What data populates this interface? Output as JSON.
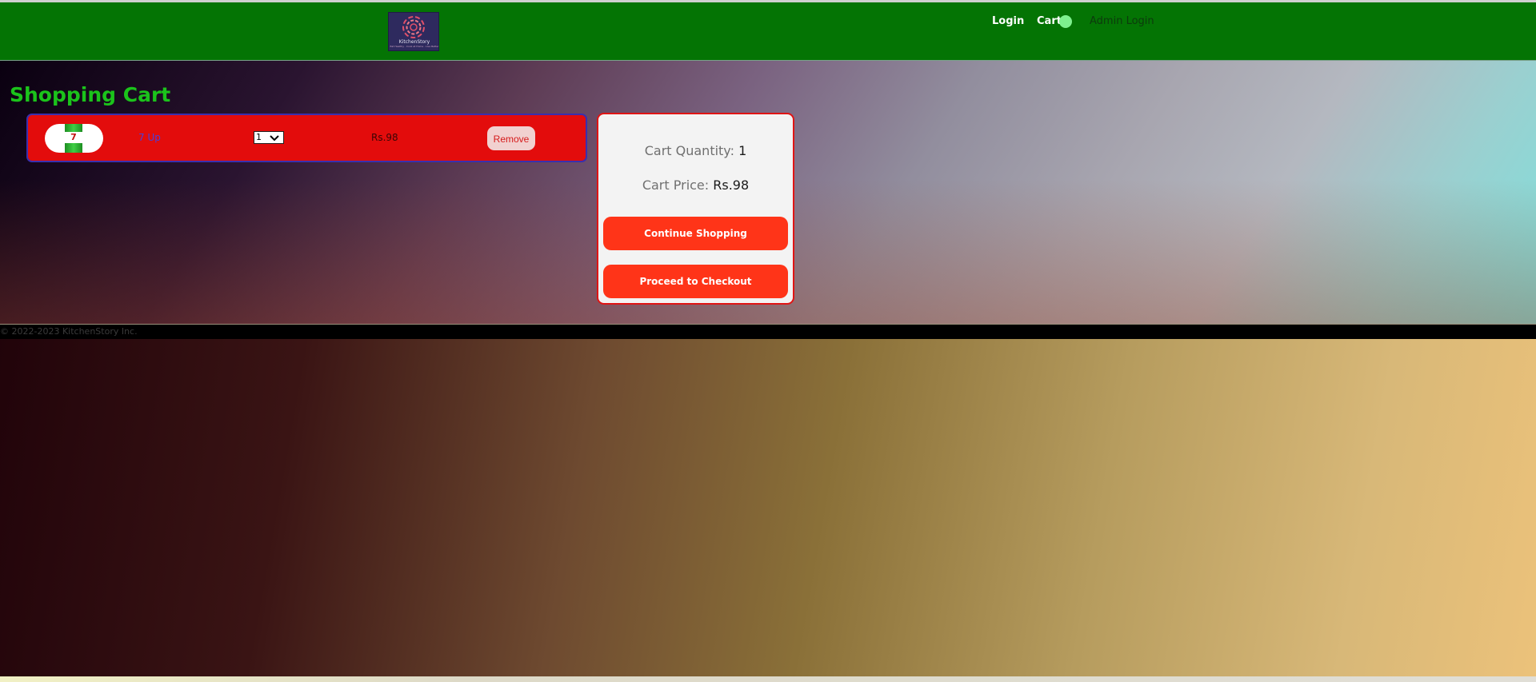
{
  "header": {
    "logo_name": "KitchenStory",
    "logo_tagline": "Eat Healthy · Cook at Home · Live Better",
    "nav": {
      "login": "Login",
      "cart": "Cart",
      "admin_login": "Admin Login"
    }
  },
  "page": {
    "title": "Shopping Cart"
  },
  "cart": {
    "items": [
      {
        "name": "7 Up",
        "quantity": "1",
        "price": "Rs.98",
        "remove_label": "Remove",
        "thumbnail_icon": "soda-can-icon"
      }
    ]
  },
  "summary": {
    "quantity_label": "Cart Quantity:",
    "quantity_value": "1",
    "price_label": "Cart Price:",
    "price_value": "Rs.98",
    "continue_label": "Continue Shopping",
    "checkout_label": "Proceed to Checkout"
  },
  "footer": {
    "copyright": "© 2022-2023 KitchenStory Inc."
  },
  "colors": {
    "navbar": "#047404",
    "title": "#1bc31b",
    "cart_item_bg": "#e30c0c",
    "cart_item_border": "#3a2fae",
    "summary_border": "#e01414",
    "action_button": "#ff3418",
    "cart_badge": "#7ef08e"
  }
}
